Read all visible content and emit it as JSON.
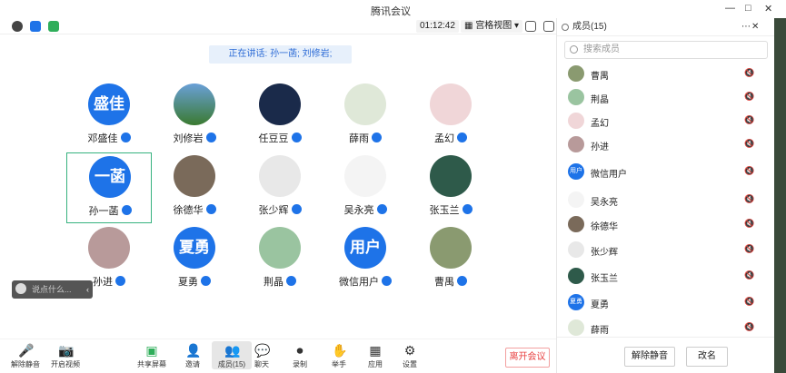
{
  "window": {
    "title": "腾讯会议",
    "min": "—",
    "max": "□",
    "close": "✕"
  },
  "toolbar": {
    "timer": "01:12:42",
    "view": "宫格视图"
  },
  "speaking": "正在讲话: 孙一菡; 刘修岩;",
  "tiles": [
    {
      "name": "邓盛佳",
      "avatar_text": "盛佳"
    },
    {
      "name": "刘修岩",
      "avatar_text": ""
    },
    {
      "name": "任豆豆",
      "avatar_text": ""
    },
    {
      "name": "薛雨",
      "avatar_text": ""
    },
    {
      "name": "孟幻",
      "avatar_text": ""
    },
    {
      "name": "孙一菡",
      "avatar_text": "一菡"
    },
    {
      "name": "徐德华",
      "avatar_text": ""
    },
    {
      "name": "张少辉",
      "avatar_text": ""
    },
    {
      "name": "吴永亮",
      "avatar_text": ""
    },
    {
      "name": "张玉兰",
      "avatar_text": ""
    },
    {
      "name": "孙进",
      "avatar_text": ""
    },
    {
      "name": "夏勇",
      "avatar_text": "夏勇"
    },
    {
      "name": "荆晶",
      "avatar_text": ""
    },
    {
      "name": "微信用户",
      "avatar_text": "用户"
    },
    {
      "name": "曹禺",
      "avatar_text": ""
    }
  ],
  "chat_placeholder": "说点什么...",
  "bottom": {
    "unmute": "解除静音",
    "video": "开启视频",
    "share": "共享屏幕",
    "invite": "邀请",
    "members": "成员(15)",
    "chat": "聊天",
    "record": "录制",
    "hand": "举手",
    "apps": "应用",
    "settings": "设置",
    "leave": "离开会议"
  },
  "panel": {
    "title": "成员(15)",
    "search_placeholder": "搜索成员",
    "members": [
      "曹禺",
      "荆晶",
      "孟幻",
      "孙进",
      "微信用户",
      "吴永亮",
      "徐德华",
      "张少辉",
      "张玉兰",
      "夏勇",
      "薛雨"
    ],
    "unmute_all": "解除静音",
    "rename": "改名"
  },
  "colors": {
    "accent": "#1e73e8",
    "leave": "#e84141",
    "selected": "#36b27f"
  }
}
